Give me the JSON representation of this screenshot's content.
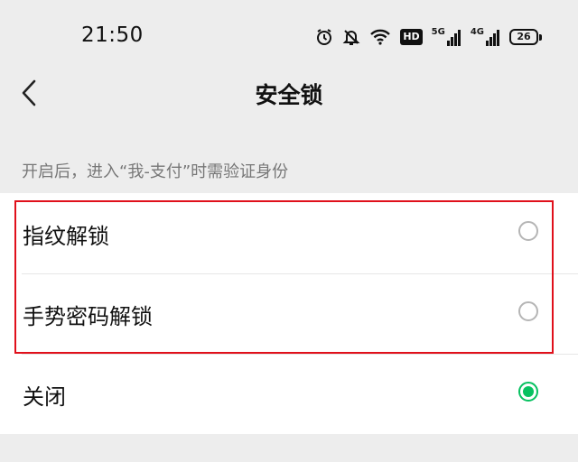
{
  "status_bar": {
    "time": "21:50",
    "hd_label": "HD",
    "signal1_label": "5G",
    "signal2_label": "4G",
    "battery": "26",
    "icons": [
      "alarm-icon",
      "bell-off-icon",
      "wifi-icon",
      "hd-icon",
      "signal-5g-icon",
      "signal-4g-icon",
      "battery-icon"
    ]
  },
  "nav": {
    "title": "安全锁",
    "back_icon": "chevron-left-icon"
  },
  "hint": "开启后，进入“我-支付”时需验证身份",
  "options": [
    {
      "label": "指纹解锁",
      "selected": false
    },
    {
      "label": "手势密码解锁",
      "selected": false
    },
    {
      "label": "关闭",
      "selected": true
    }
  ],
  "colors": {
    "accent": "#07c160",
    "highlight": "#e0101b",
    "background": "#ededed"
  }
}
